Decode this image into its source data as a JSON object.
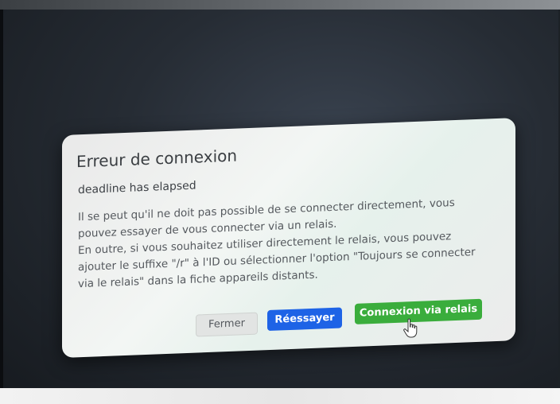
{
  "dialog": {
    "title": "Erreur de connexion",
    "error": "deadline has elapsed",
    "message_lines": [
      "Il se peut qu'il ne doit pas possible de se connecter directement, vous",
      "pouvez essayer de vous connecter via un relais.",
      "En outre, si vous souhaitez utiliser directement le relais, vous pouvez",
      "ajouter le suffixe \"/r\" à l'ID ou sélectionner l'option \"Toujours se connecter",
      "via le relais\" dans la fiche appareils distants."
    ],
    "buttons": {
      "close_label": "Fermer",
      "retry_label": "Réessayer",
      "relay_label": "Connexion via relais"
    }
  },
  "colors": {
    "retry_button": "#1e63e6",
    "relay_button": "#3aad3c",
    "close_button": "#e2e4e3"
  },
  "icons": {
    "cursor": "hand-pointer-icon"
  }
}
